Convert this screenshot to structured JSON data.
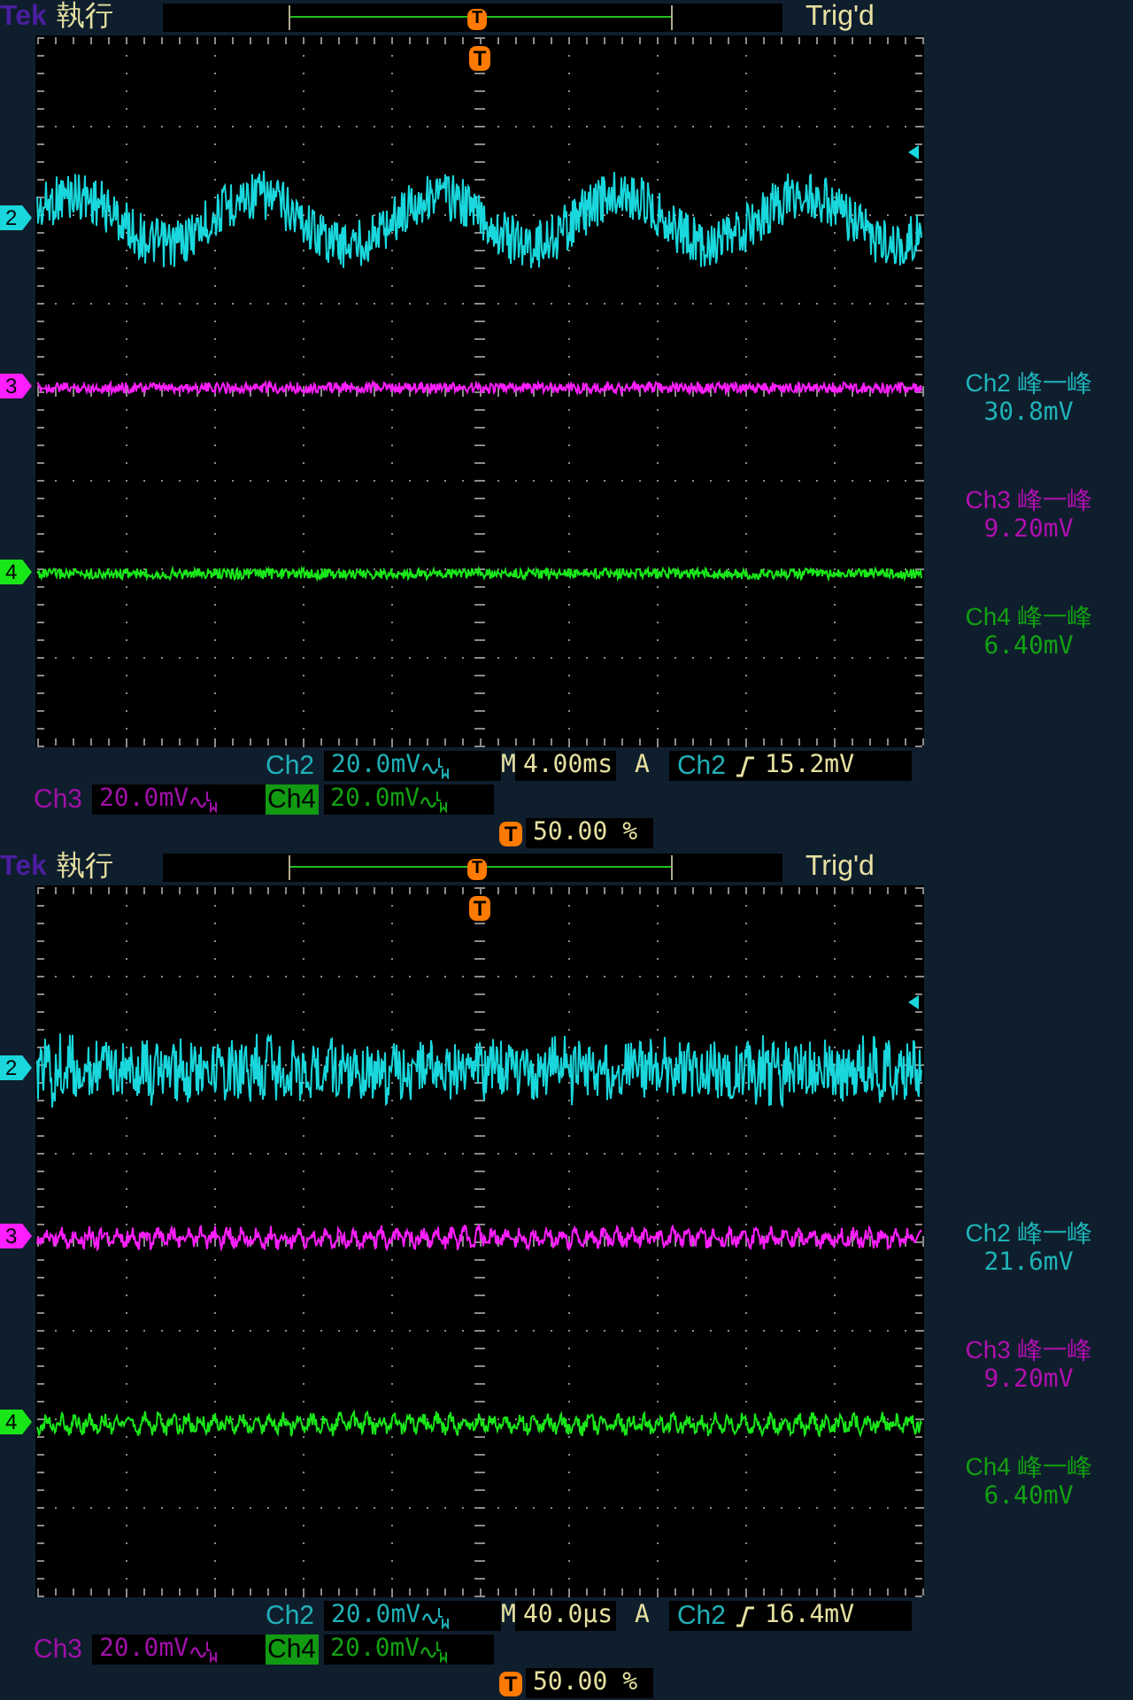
{
  "panels": [
    {
      "header": {
        "brand": "Tek",
        "status": "執行",
        "trigger_state": "Trig'd",
        "trigger_marker": "T",
        "screen_marker": "T"
      },
      "traces": [
        {
          "label": "2",
          "color": "#19d7dc",
          "kind": "sine"
        },
        {
          "label": "3",
          "color": "#ff1eff",
          "kind": "flat"
        },
        {
          "label": "4",
          "color": "#19e619",
          "kind": "flat"
        }
      ],
      "measurements": [
        {
          "label": "Ch2 峰一峰",
          "value": "30.8mV",
          "color": "#1fb4b8"
        },
        {
          "label": "Ch3 峰一峰",
          "value": "9.20mV",
          "color": "#b010b0"
        },
        {
          "label": "Ch4 峰一峰",
          "value": "6.40mV",
          "color": "#12a012"
        }
      ],
      "ch2_scale": {
        "label": "Ch2",
        "value": "20.0mV"
      },
      "timebase": {
        "label": "M",
        "value": "4.00ms"
      },
      "trigger": {
        "label": "A",
        "source": "Ch2",
        "level": "15.2mV"
      },
      "ch3_scale": {
        "label": "Ch3",
        "value": "20.0mV"
      },
      "ch4_scale": {
        "label": "Ch4",
        "value": "20.0mV"
      },
      "trigger_position": {
        "marker": "T",
        "value": "50.00 %"
      }
    },
    {
      "header": {
        "brand": "Tek",
        "status": "執行",
        "trigger_state": "Trig'd",
        "trigger_marker": "T",
        "screen_marker": "T"
      },
      "traces": [
        {
          "label": "2",
          "color": "#19d7dc",
          "kind": "burst"
        },
        {
          "label": "3",
          "color": "#ff1eff",
          "kind": "ripple"
        },
        {
          "label": "4",
          "color": "#19e619",
          "kind": "ripple"
        }
      ],
      "measurements": [
        {
          "label": "Ch2 峰一峰",
          "value": "21.6mV",
          "color": "#1fb4b8"
        },
        {
          "label": "Ch3 峰一峰",
          "value": "9.20mV",
          "color": "#b010b0"
        },
        {
          "label": "Ch4 峰一峰",
          "value": "6.40mV",
          "color": "#12a012"
        }
      ],
      "ch2_scale": {
        "label": "Ch2",
        "value": "20.0mV"
      },
      "timebase": {
        "label": "M",
        "value": "40.0µs"
      },
      "trigger": {
        "label": "A",
        "source": "Ch2",
        "level": "16.4mV"
      },
      "ch3_scale": {
        "label": "Ch3",
        "value": "20.0mV"
      },
      "ch4_scale": {
        "label": "Ch4",
        "value": "20.0mV"
      },
      "trigger_position": {
        "marker": "T",
        "value": "50.00 %"
      }
    }
  ]
}
